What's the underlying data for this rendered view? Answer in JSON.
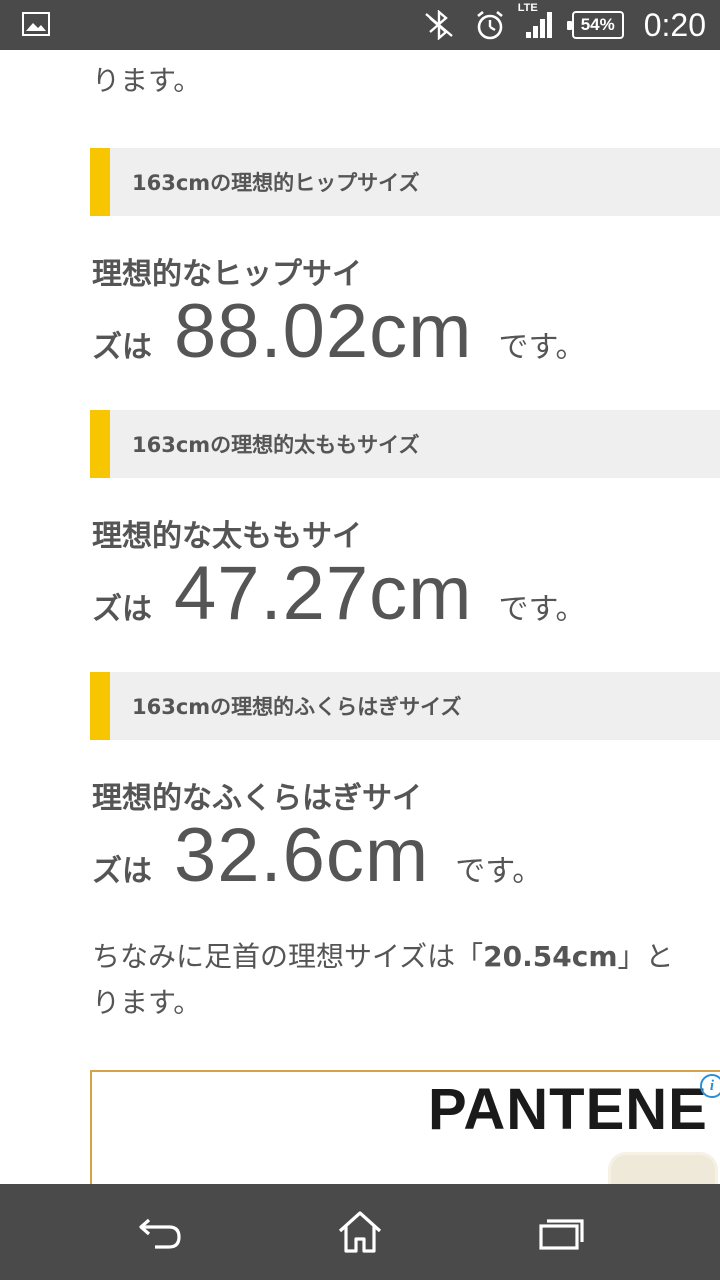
{
  "status_bar": {
    "network_label": "LTE",
    "battery": "54%",
    "time": "0:20"
  },
  "article": {
    "intro_tail": "ります。",
    "sections": [
      {
        "heading": "163cmの理想的ヒップサイズ",
        "line1": "理想的なヒップサイ",
        "pre": "ズは",
        "value": "88.02cm",
        "post": "です。"
      },
      {
        "heading": "163cmの理想的太ももサイズ",
        "line1": "理想的な太ももサイ",
        "pre": "ズは",
        "value": "47.27cm",
        "post": "です。"
      },
      {
        "heading": "163cmの理想的ふくらはぎサイズ",
        "line1": "理想的なふくらはぎサイ",
        "pre": "ズは",
        "value": "32.6cm",
        "post": "です。"
      }
    ],
    "ankle_note": {
      "before": "ちなみに足首の理想サイズは「",
      "value": "20.54cm",
      "after": "」と",
      "line2": "ります。"
    }
  },
  "ad": {
    "brand": "PANTENE",
    "info_icon": "i"
  },
  "colors": {
    "status_bar": "#4a4a4a",
    "accent": "#f7c600",
    "heading_bg": "#efefef",
    "text": "#555555"
  }
}
